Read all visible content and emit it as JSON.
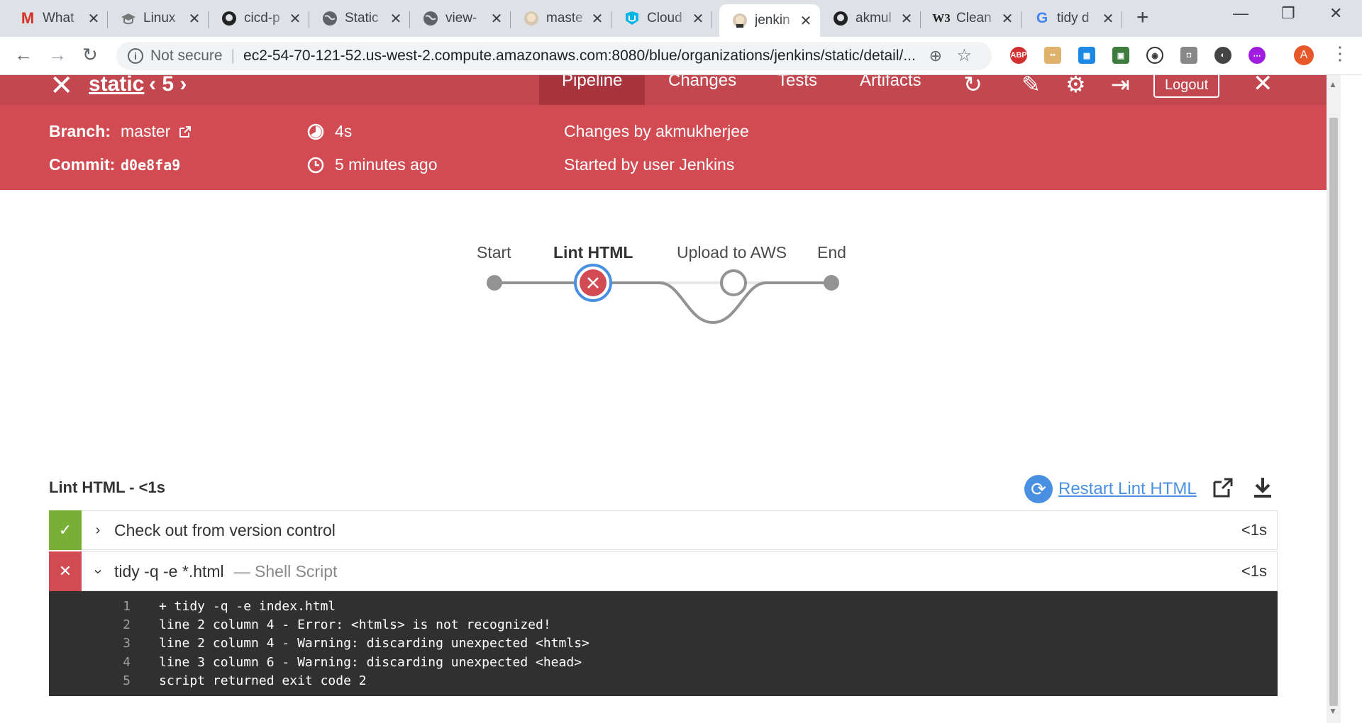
{
  "browser": {
    "tabs": [
      {
        "label": "What",
        "icon": "gmail-icon"
      },
      {
        "label": "Linux",
        "icon": "mortarboard-icon"
      },
      {
        "label": "cicd-p",
        "icon": "github-icon"
      },
      {
        "label": "Static",
        "icon": "globe-icon"
      },
      {
        "label": "view-",
        "icon": "globe-icon"
      },
      {
        "label": "maste",
        "icon": "jenkins-icon"
      },
      {
        "label": "Cloud",
        "icon": "udacity-icon"
      },
      {
        "label": "jenkin",
        "icon": "jenkins-icon",
        "active": true
      },
      {
        "label": "akmul",
        "icon": "github-icon"
      },
      {
        "label": "Clean",
        "icon": "w3schools-icon"
      },
      {
        "label": "tidy d",
        "icon": "google-icon"
      }
    ],
    "security_label": "Not secure",
    "url": "ec2-54-70-121-52.us-west-2.compute.amazonaws.com:8080/blue/organizations/jenkins/static/detail/...",
    "profile_initial": "A"
  },
  "run": {
    "job_name": "static",
    "run_number": "5",
    "nav": [
      "Pipeline",
      "Changes",
      "Tests",
      "Artifacts"
    ],
    "logout_label": "Logout",
    "branch_label": "Branch:",
    "branch_value": "master",
    "commit_label": "Commit:",
    "commit_value": "d0e8fa9",
    "duration": "4s",
    "time_ago": "5 minutes ago",
    "changes_by": "Changes by akmukherjee",
    "started_by": "Started by user Jenkins",
    "colors": {
      "header": "#d24a52",
      "header_dark": "#c2474f",
      "success": "#78b037",
      "failure": "#d24a52",
      "link": "#4a90e2"
    }
  },
  "pipeline": {
    "stages": [
      {
        "name": "Start",
        "status": "node"
      },
      {
        "name": "Lint HTML",
        "status": "failed",
        "selected": true
      },
      {
        "name": "Upload to AWS",
        "status": "not-built"
      },
      {
        "name": "End",
        "status": "node"
      }
    ]
  },
  "step_detail": {
    "title": "Lint HTML - <1s",
    "restart_label": "Restart Lint HTML",
    "steps": [
      {
        "status": "success",
        "name": "Check out from version control",
        "type": "",
        "duration": "<1s",
        "expanded": false
      },
      {
        "status": "failed",
        "name": "tidy -q -e *.html",
        "type": "— Shell Script",
        "duration": "<1s",
        "expanded": true
      }
    ],
    "log": [
      {
        "n": "1",
        "text": "+ tidy -q -e index.html"
      },
      {
        "n": "2",
        "text": "line 2 column 4 - Error: <htmls> is not recognized!"
      },
      {
        "n": "3",
        "text": "line 2 column 4 - Warning: discarding unexpected <htmls>"
      },
      {
        "n": "4",
        "text": "line 3 column 6 - Warning: discarding unexpected <head>"
      },
      {
        "n": "5",
        "text": "script returned exit code 2"
      }
    ]
  }
}
